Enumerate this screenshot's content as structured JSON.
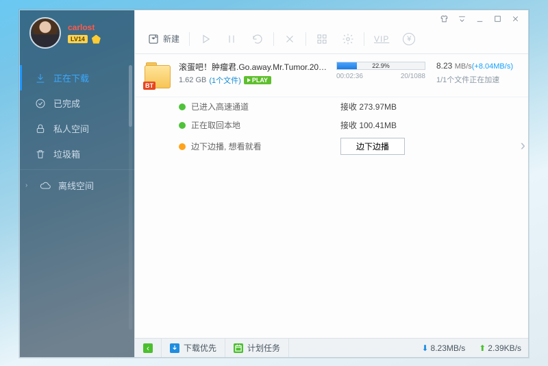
{
  "profile": {
    "name": "carlost",
    "level": "LV14"
  },
  "sidebar": {
    "items": [
      {
        "label": "正在下载"
      },
      {
        "label": "已完成"
      },
      {
        "label": "私人空间"
      },
      {
        "label": "垃圾箱"
      },
      {
        "label": "离线空间"
      }
    ]
  },
  "toolbar": {
    "new_label": "新建",
    "vip": "VIP"
  },
  "task": {
    "name": "滚蛋吧！肿瘤君.Go.away.Mr.Tumor.2015...",
    "size": "1.62 GB",
    "file_count": "(1个文件)",
    "play": "PLAY",
    "bt": "BT",
    "percent": "22.9%",
    "percent_num": 22.9,
    "elapsed": "00:02:36",
    "peers": "20/1088",
    "speed_val": "8.23",
    "speed_unit": "MB/s",
    "speed_bonus": "(+8.04MB/s)",
    "accel_status": "1/1个文件正在加速"
  },
  "detail": {
    "row1_label": "已进入高速通道",
    "row1_value": "接收 273.97MB",
    "row2_label": "正在取回本地",
    "row2_value": "接收 100.41MB",
    "row3_label": "边下边播, 想看就看",
    "play_while": "边下边播"
  },
  "status": {
    "priority": "下载优先",
    "schedule": "计划任务",
    "down": "8.23MB/s",
    "up": "2.39KB/s"
  }
}
